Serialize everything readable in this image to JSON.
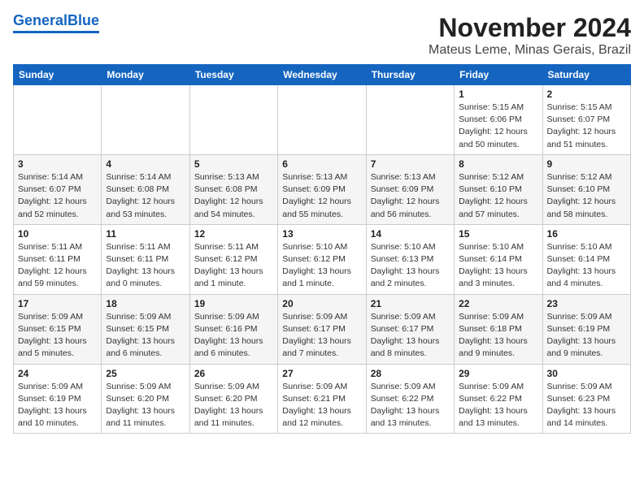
{
  "header": {
    "logo_general": "General",
    "logo_blue": "Blue",
    "month_title": "November 2024",
    "location": "Mateus Leme, Minas Gerais, Brazil"
  },
  "weekdays": [
    "Sunday",
    "Monday",
    "Tuesday",
    "Wednesday",
    "Thursday",
    "Friday",
    "Saturday"
  ],
  "weeks": [
    [
      {
        "day": "",
        "info": ""
      },
      {
        "day": "",
        "info": ""
      },
      {
        "day": "",
        "info": ""
      },
      {
        "day": "",
        "info": ""
      },
      {
        "day": "",
        "info": ""
      },
      {
        "day": "1",
        "info": "Sunrise: 5:15 AM\nSunset: 6:06 PM\nDaylight: 12 hours and 50 minutes."
      },
      {
        "day": "2",
        "info": "Sunrise: 5:15 AM\nSunset: 6:07 PM\nDaylight: 12 hours and 51 minutes."
      }
    ],
    [
      {
        "day": "3",
        "info": "Sunrise: 5:14 AM\nSunset: 6:07 PM\nDaylight: 12 hours and 52 minutes."
      },
      {
        "day": "4",
        "info": "Sunrise: 5:14 AM\nSunset: 6:08 PM\nDaylight: 12 hours and 53 minutes."
      },
      {
        "day": "5",
        "info": "Sunrise: 5:13 AM\nSunset: 6:08 PM\nDaylight: 12 hours and 54 minutes."
      },
      {
        "day": "6",
        "info": "Sunrise: 5:13 AM\nSunset: 6:09 PM\nDaylight: 12 hours and 55 minutes."
      },
      {
        "day": "7",
        "info": "Sunrise: 5:13 AM\nSunset: 6:09 PM\nDaylight: 12 hours and 56 minutes."
      },
      {
        "day": "8",
        "info": "Sunrise: 5:12 AM\nSunset: 6:10 PM\nDaylight: 12 hours and 57 minutes."
      },
      {
        "day": "9",
        "info": "Sunrise: 5:12 AM\nSunset: 6:10 PM\nDaylight: 12 hours and 58 minutes."
      }
    ],
    [
      {
        "day": "10",
        "info": "Sunrise: 5:11 AM\nSunset: 6:11 PM\nDaylight: 12 hours and 59 minutes."
      },
      {
        "day": "11",
        "info": "Sunrise: 5:11 AM\nSunset: 6:11 PM\nDaylight: 13 hours and 0 minutes."
      },
      {
        "day": "12",
        "info": "Sunrise: 5:11 AM\nSunset: 6:12 PM\nDaylight: 13 hours and 1 minute."
      },
      {
        "day": "13",
        "info": "Sunrise: 5:10 AM\nSunset: 6:12 PM\nDaylight: 13 hours and 1 minute."
      },
      {
        "day": "14",
        "info": "Sunrise: 5:10 AM\nSunset: 6:13 PM\nDaylight: 13 hours and 2 minutes."
      },
      {
        "day": "15",
        "info": "Sunrise: 5:10 AM\nSunset: 6:14 PM\nDaylight: 13 hours and 3 minutes."
      },
      {
        "day": "16",
        "info": "Sunrise: 5:10 AM\nSunset: 6:14 PM\nDaylight: 13 hours and 4 minutes."
      }
    ],
    [
      {
        "day": "17",
        "info": "Sunrise: 5:09 AM\nSunset: 6:15 PM\nDaylight: 13 hours and 5 minutes."
      },
      {
        "day": "18",
        "info": "Sunrise: 5:09 AM\nSunset: 6:15 PM\nDaylight: 13 hours and 6 minutes."
      },
      {
        "day": "19",
        "info": "Sunrise: 5:09 AM\nSunset: 6:16 PM\nDaylight: 13 hours and 6 minutes."
      },
      {
        "day": "20",
        "info": "Sunrise: 5:09 AM\nSunset: 6:17 PM\nDaylight: 13 hours and 7 minutes."
      },
      {
        "day": "21",
        "info": "Sunrise: 5:09 AM\nSunset: 6:17 PM\nDaylight: 13 hours and 8 minutes."
      },
      {
        "day": "22",
        "info": "Sunrise: 5:09 AM\nSunset: 6:18 PM\nDaylight: 13 hours and 9 minutes."
      },
      {
        "day": "23",
        "info": "Sunrise: 5:09 AM\nSunset: 6:19 PM\nDaylight: 13 hours and 9 minutes."
      }
    ],
    [
      {
        "day": "24",
        "info": "Sunrise: 5:09 AM\nSunset: 6:19 PM\nDaylight: 13 hours and 10 minutes."
      },
      {
        "day": "25",
        "info": "Sunrise: 5:09 AM\nSunset: 6:20 PM\nDaylight: 13 hours and 11 minutes."
      },
      {
        "day": "26",
        "info": "Sunrise: 5:09 AM\nSunset: 6:20 PM\nDaylight: 13 hours and 11 minutes."
      },
      {
        "day": "27",
        "info": "Sunrise: 5:09 AM\nSunset: 6:21 PM\nDaylight: 13 hours and 12 minutes."
      },
      {
        "day": "28",
        "info": "Sunrise: 5:09 AM\nSunset: 6:22 PM\nDaylight: 13 hours and 13 minutes."
      },
      {
        "day": "29",
        "info": "Sunrise: 5:09 AM\nSunset: 6:22 PM\nDaylight: 13 hours and 13 minutes."
      },
      {
        "day": "30",
        "info": "Sunrise: 5:09 AM\nSunset: 6:23 PM\nDaylight: 13 hours and 14 minutes."
      }
    ]
  ]
}
